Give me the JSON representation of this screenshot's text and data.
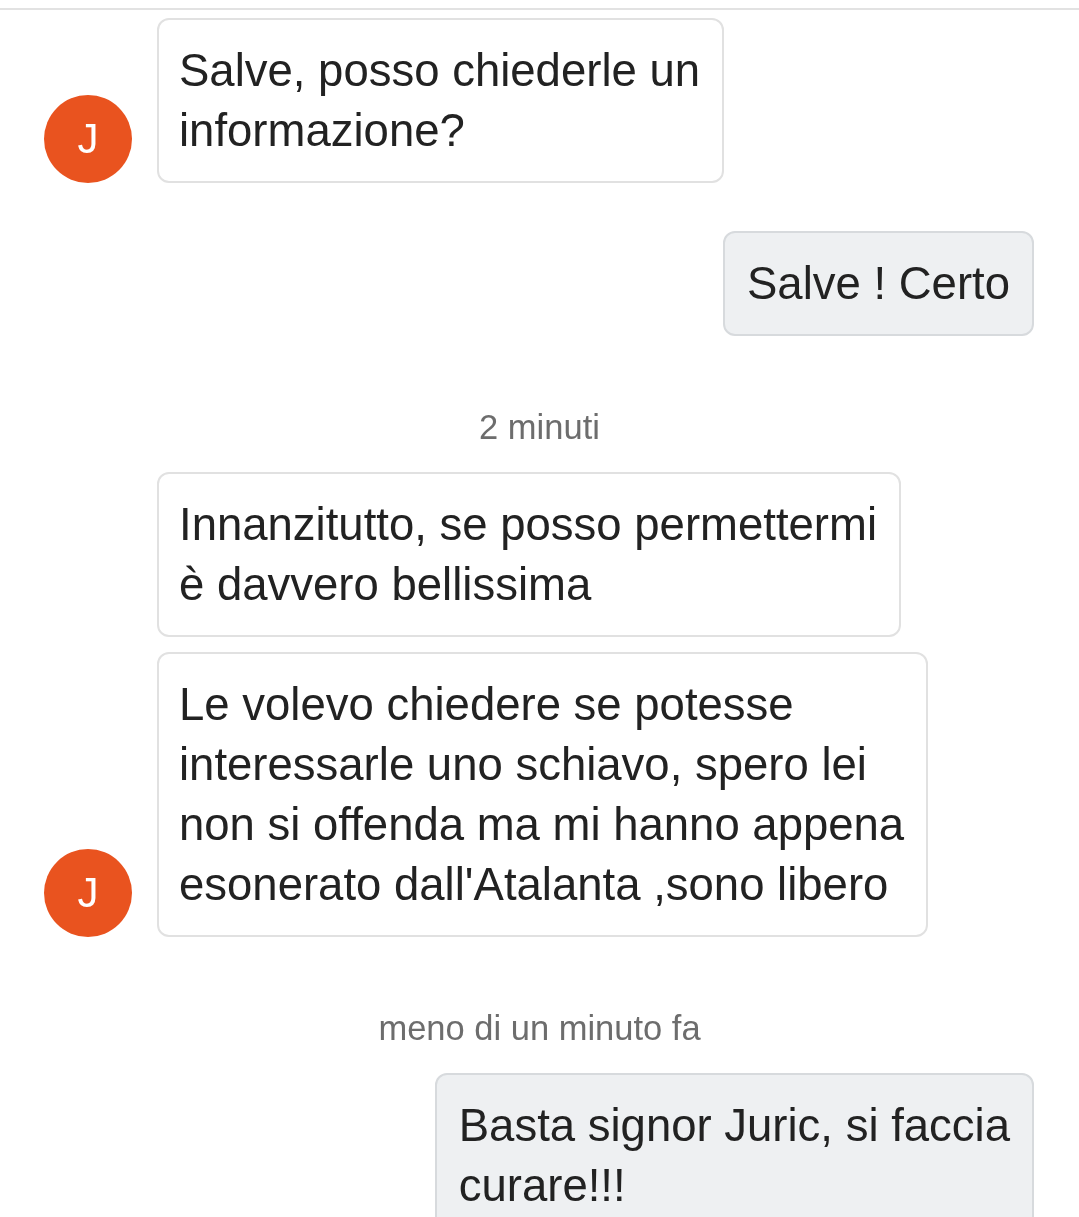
{
  "chat": {
    "items": [
      {
        "kind": "incoming",
        "avatar": "J",
        "text": "Salve, posso chiederle un\ninformazione?"
      },
      {
        "kind": "outgoing",
        "text": "Salve ! Certo"
      },
      {
        "kind": "timestamp",
        "text": "2 minuti"
      },
      {
        "kind": "incoming",
        "text": "Innanzitutto, se posso permettermi\nè davvero bellissima"
      },
      {
        "kind": "incoming",
        "avatar": "J",
        "text": "Le volevo chiedere se potesse\ninteressarle uno schiavo, spero lei\nnon si offenda ma mi hanno appena\nesonerato dall'Atalanta ,sono libero"
      },
      {
        "kind": "timestamp",
        "text": "meno di un minuto fa"
      },
      {
        "kind": "outgoing",
        "text": "Basta signor Juric, si faccia\ncurare!!!"
      }
    ]
  }
}
